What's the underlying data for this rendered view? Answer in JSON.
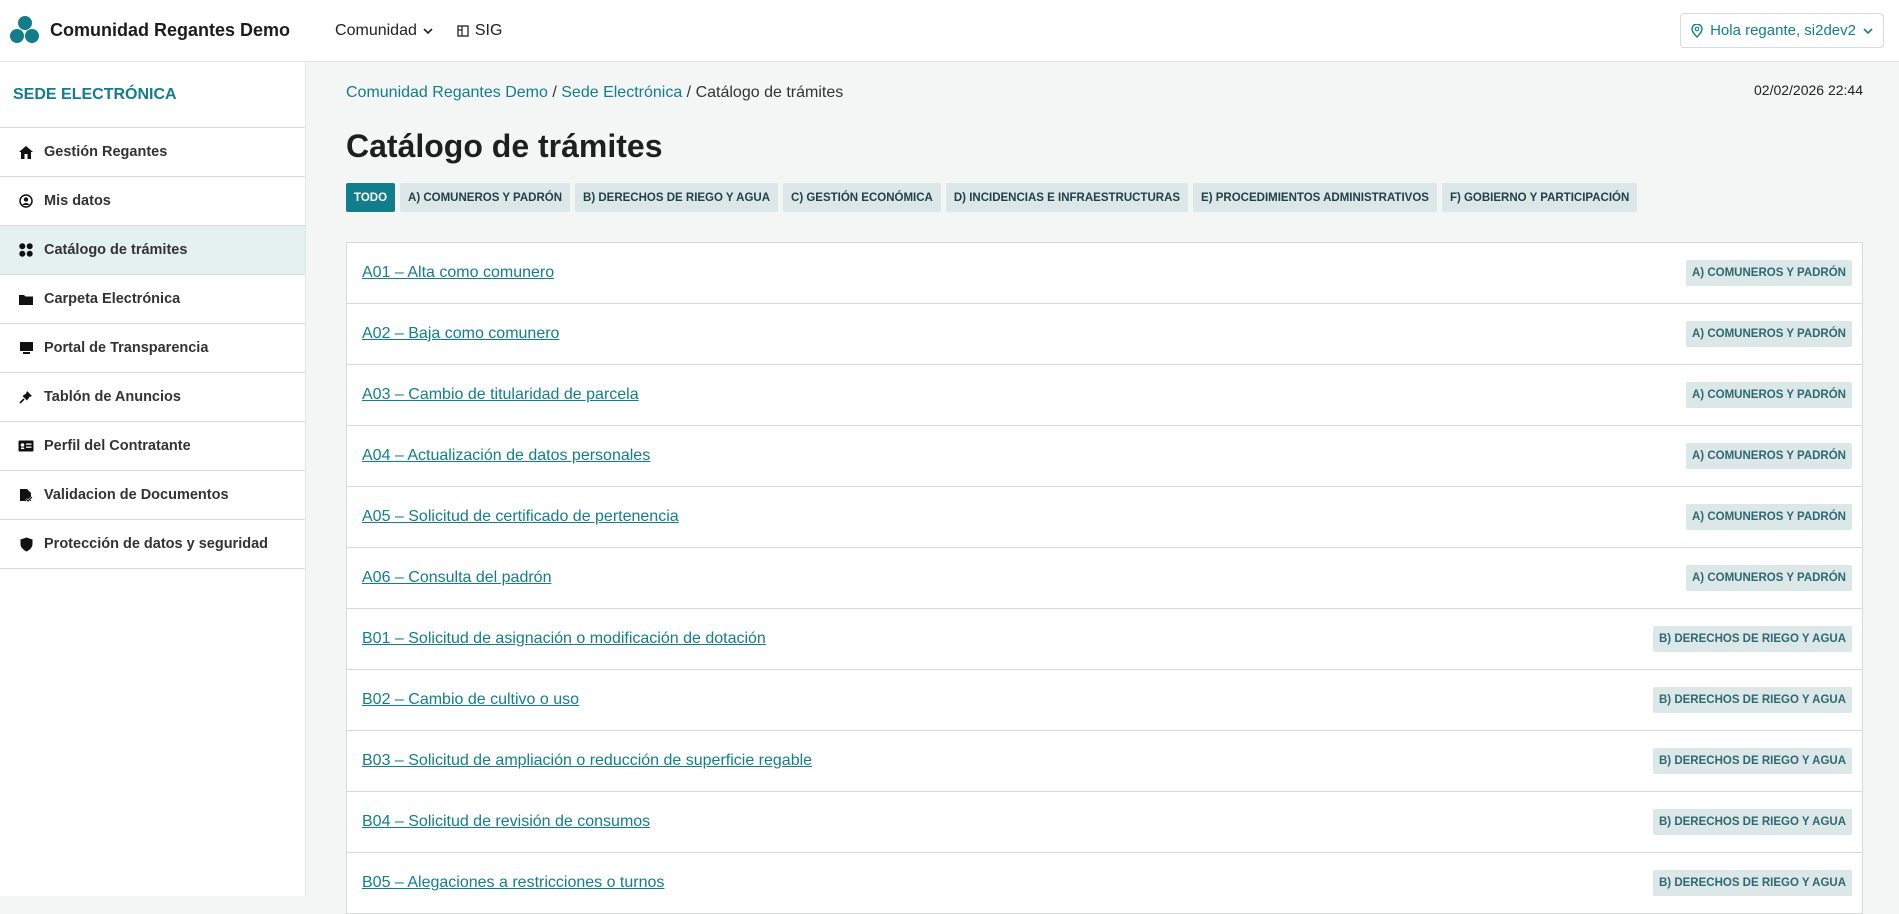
{
  "header": {
    "brand": "Comunidad Regantes Demo",
    "nav": [
      {
        "label": "Comunidad",
        "icon": "chevron-down-icon"
      },
      {
        "label": "SIG",
        "icon": "map-icon"
      }
    ],
    "user_label": "Hola regante, si2dev2"
  },
  "sidebar": {
    "title": "SEDE ELECTRÓNICA",
    "items": [
      {
        "label": "Gestión Regantes",
        "icon": "home-icon"
      },
      {
        "label": "Mis datos",
        "icon": "user-icon"
      },
      {
        "label": "Catálogo de trámites",
        "icon": "grid-icon",
        "active": true
      },
      {
        "label": "Carpeta Electrónica",
        "icon": "folder-icon"
      },
      {
        "label": "Portal de Transparencia",
        "icon": "monitor-icon"
      },
      {
        "label": "Tablón de Anuncios",
        "icon": "pin-icon"
      },
      {
        "label": "Perfil del Contratante",
        "icon": "id-card-icon"
      },
      {
        "label": "Validacion de Documentos",
        "icon": "document-check-icon"
      },
      {
        "label": "Protección de datos y seguridad",
        "icon": "shield-icon"
      }
    ]
  },
  "breadcrumb": {
    "home": "Comunidad Regantes Demo",
    "sede": "Sede Electrónica",
    "current": "Catálogo de trámites",
    "sep": "/"
  },
  "datetime": "02/02/2026 22:44",
  "page_title": "Catálogo de trámites",
  "filters": [
    "TODO",
    "A) COMUNEROS Y PADRÓN",
    "B) DERECHOS DE RIEGO Y AGUA",
    "C) GESTIÓN ECONÓMICA",
    "D) INCIDENCIAS E INFRAESTRUCTURAS",
    "E) PROCEDIMIENTOS ADMINISTRATIVOS",
    "F) GOBIERNO Y PARTICIPACIÓN"
  ],
  "tramites": [
    {
      "title": "A01 – Alta como comunero",
      "category": "A) COMUNEROS Y PADRÓN"
    },
    {
      "title": "A02 – Baja como comunero",
      "category": "A) COMUNEROS Y PADRÓN"
    },
    {
      "title": "A03 – Cambio de titularidad de parcela",
      "category": "A) COMUNEROS Y PADRÓN"
    },
    {
      "title": "A04 – Actualización de datos personales",
      "category": "A) COMUNEROS Y PADRÓN"
    },
    {
      "title": "A05 – Solicitud de certificado de pertenencia",
      "category": "A) COMUNEROS Y PADRÓN"
    },
    {
      "title": "A06 – Consulta del padrón",
      "category": "A) COMUNEROS Y PADRÓN"
    },
    {
      "title": "B01 – Solicitud de asignación o modificación de dotación",
      "category": "B) DERECHOS DE RIEGO Y AGUA"
    },
    {
      "title": "B02 – Cambio de cultivo o uso",
      "category": "B) DERECHOS DE RIEGO Y AGUA"
    },
    {
      "title": "B03 – Solicitud de ampliación o reducción de superficie regable",
      "category": "B) DERECHOS DE RIEGO Y AGUA"
    },
    {
      "title": "B04 – Solicitud de revisión de consumos",
      "category": "B) DERECHOS DE RIEGO Y AGUA"
    },
    {
      "title": "B05 – Alegaciones a restricciones o turnos",
      "category": "B) DERECHOS DE RIEGO Y AGUA"
    }
  ]
}
